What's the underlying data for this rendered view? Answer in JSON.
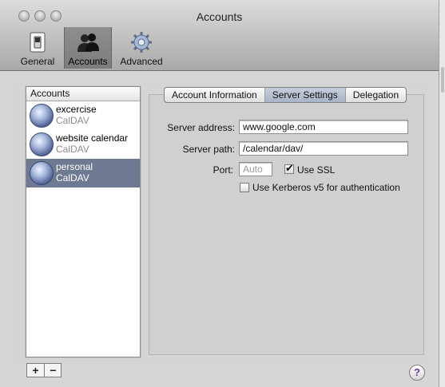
{
  "window": {
    "title": "Accounts"
  },
  "toolbar": {
    "items": [
      {
        "label": "General",
        "icon": "light-switch-icon"
      },
      {
        "label": "Accounts",
        "icon": "people-icon",
        "selected": true
      },
      {
        "label": "Advanced",
        "icon": "gear-icon"
      }
    ]
  },
  "sidebar": {
    "header": "Accounts",
    "accounts": [
      {
        "name": "excercise",
        "type": "CalDAV"
      },
      {
        "name": "website calendar",
        "type": "CalDAV"
      },
      {
        "name": "personal",
        "type": "CalDAV",
        "selected": true
      }
    ],
    "add_label": "+",
    "remove_label": "−"
  },
  "tabs": [
    {
      "label": "Account Information"
    },
    {
      "label": "Server Settings",
      "selected": true
    },
    {
      "label": "Delegation"
    }
  ],
  "server_settings": {
    "server_address_label": "Server address:",
    "server_address_value": "www.google.com",
    "server_path_label": "Server path:",
    "server_path_value": "/calendar/dav/",
    "port_label": "Port:",
    "port_placeholder": "Auto",
    "use_ssl_label": "Use SSL",
    "use_ssl_checked": true,
    "kerberos_label": "Use Kerberos v5 for authentication",
    "kerberos_checked": false
  },
  "help_label": "?"
}
